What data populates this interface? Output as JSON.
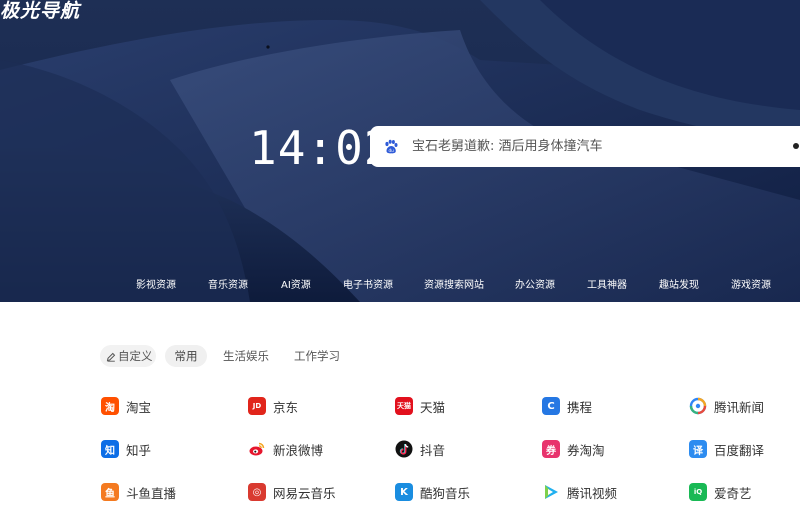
{
  "brand": {
    "logo_text": "极光导航"
  },
  "clock": {
    "time": "14:02"
  },
  "search": {
    "placeholder": "宝石老舅道歉: 酒后用身体撞汽车",
    "engine_icon": "baidu-paw-icon"
  },
  "categories": [
    "影视资源",
    "音乐资源",
    "AI资源",
    "电子书资源",
    "资源搜索网站",
    "办公资源",
    "工具神器",
    "趣站发现",
    "游戏资源"
  ],
  "tabs": {
    "custom_label": "自定义",
    "items": [
      "常用",
      "生活娱乐",
      "工作学习"
    ],
    "active": "常用"
  },
  "links": [
    {
      "label": "淘宝",
      "icon": "taobao-icon",
      "glyph": "淘",
      "color": "#ff5000"
    },
    {
      "label": "京东",
      "icon": "jd-icon",
      "glyph": "JD",
      "color": "#e1251b"
    },
    {
      "label": "天猫",
      "icon": "tmall-icon",
      "glyph": "天猫",
      "color": "#e2101d"
    },
    {
      "label": "携程",
      "icon": "ctrip-icon",
      "glyph": "C",
      "color": "#2577e3"
    },
    {
      "label": "腾讯新闻",
      "icon": "tencent-news-icon",
      "glyph": "",
      "color": "#ffffff"
    },
    {
      "label": "知乎",
      "icon": "zhihu-icon",
      "glyph": "知",
      "color": "#0d6ee6"
    },
    {
      "label": "新浪微博",
      "icon": "weibo-icon",
      "glyph": "",
      "color": "#ffffff"
    },
    {
      "label": "抖音",
      "icon": "douyin-icon",
      "glyph": "♪",
      "color": "#111111"
    },
    {
      "label": "券淘淘",
      "icon": "quantaotao-icon",
      "glyph": "券",
      "color": "#e8336d"
    },
    {
      "label": "百度翻译",
      "icon": "baidu-translate-icon",
      "glyph": "译",
      "color": "#2d8cf0"
    },
    {
      "label": "斗鱼直播",
      "icon": "douyu-icon",
      "glyph": "鱼",
      "color": "#f47a20"
    },
    {
      "label": "网易云音乐",
      "icon": "netease-music-icon",
      "glyph": "◎",
      "color": "#d93a30"
    },
    {
      "label": "酷狗音乐",
      "icon": "kugou-icon",
      "glyph": "K",
      "color": "#1a8de0"
    },
    {
      "label": "腾讯视频",
      "icon": "tencent-video-icon",
      "glyph": "",
      "color": "#ffffff"
    },
    {
      "label": "爱奇艺",
      "icon": "iqiyi-icon",
      "glyph": "iQ",
      "color": "#19b955"
    }
  ]
}
